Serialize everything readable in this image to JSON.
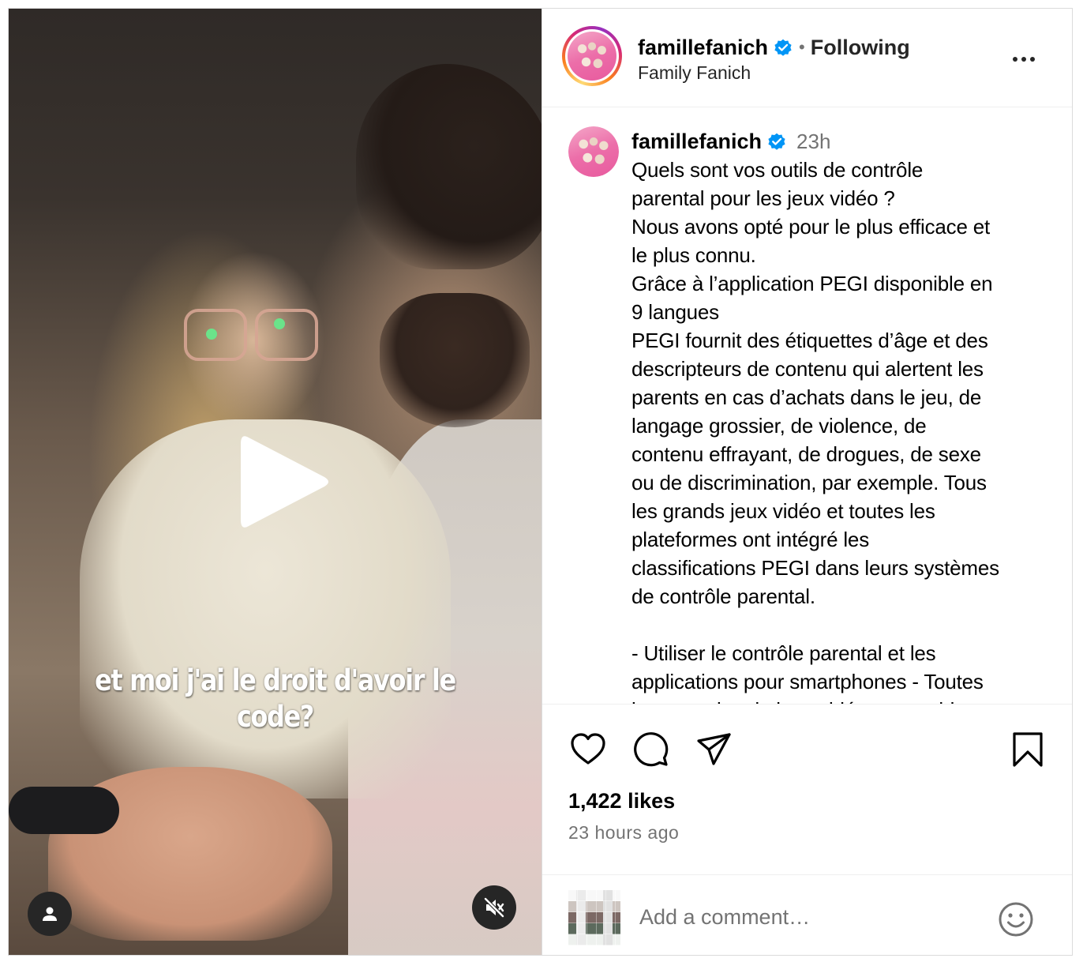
{
  "video": {
    "caption_line1": "et moi j'ai le droit d'avoir le",
    "caption_line2": "code?"
  },
  "header": {
    "username": "famillefanich",
    "separator": "•",
    "follow_status": "Following",
    "display_name": "Family Fanich"
  },
  "post": {
    "username": "famillefanich",
    "time": "23h",
    "caption": "Quels sont vos outils de contrôle\nparental pour les jeux vidéo ?\nNous avons opté pour le plus efficace et\nle plus connu.\nGrâce à l’application PEGI disponible en\n9 langues\nPEGI fournit des étiquettes d’âge et des\ndescripteurs de contenu qui alertent les\nparents en cas d’achats dans le jeu, de\nlangage grossier, de violence, de\ncontenu effrayant, de drogues, de sexe\nou de discrimination, par exemple. Tous\nles grands jeux vidéo et toutes les\nplateformes ont intégré les\nclassifications PEGI dans leurs systèmes\nde contrôle parental.\n\n- Utiliser le contrôle parental et les\napplications pour smartphones - Toutes\nles consoles de jeux vidéo, ensemble"
  },
  "actions": {
    "likes": "1,422 likes",
    "timestamp": "23 hours ago"
  },
  "comment_box": {
    "placeholder": "Add a comment…"
  },
  "colors": {
    "verified": "#0095f6",
    "secondary_text": "#737373",
    "border": "#dbdbdb"
  },
  "icons": [
    "play-icon",
    "user-tag-icon",
    "muted-speaker-icon",
    "verified-badge-icon",
    "more-options-icon",
    "heart-icon",
    "comment-icon",
    "share-icon",
    "bookmark-icon",
    "emoji-icon"
  ]
}
